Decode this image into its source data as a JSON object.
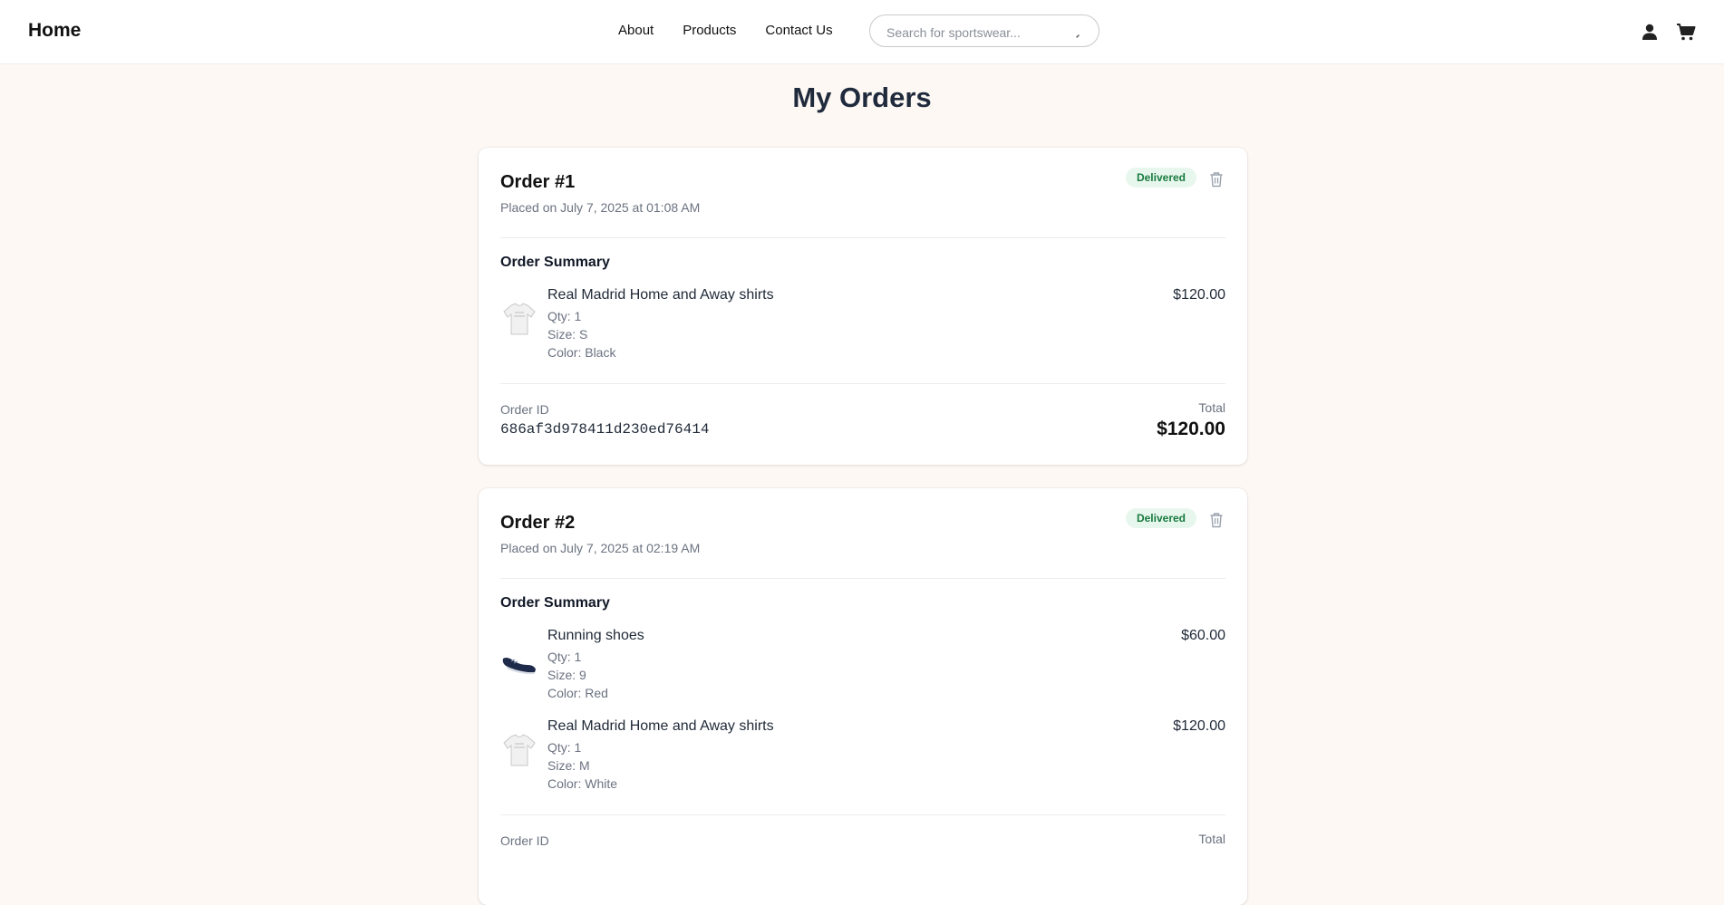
{
  "header": {
    "brand": "Home",
    "nav": [
      "About",
      "Products",
      "Contact Us"
    ],
    "search_placeholder": "Search for sportswear..."
  },
  "page": {
    "title": "My Orders"
  },
  "colors": {
    "accent": "#1f2a3c",
    "delivered_bg": "#e8f7ed",
    "delivered_text": "#177a3e",
    "page_bg": "#fdf8f4"
  },
  "orders": [
    {
      "title": "Order #1",
      "date": "Placed on July 7, 2025 at 01:08 AM",
      "status": "Delivered",
      "summary_title": "Order Summary",
      "items": [
        {
          "name": "Real Madrid Home and Away shirts",
          "qty": "Qty: 1",
          "size": "Size: S",
          "color": "Color: Black",
          "price": "$120.00",
          "icon": "shirt-icon"
        }
      ],
      "id_label": "Order ID",
      "id": "686af3d978411d230ed76414",
      "total_label": "Total",
      "total": "$120.00"
    },
    {
      "title": "Order #2",
      "date": "Placed on July 7, 2025 at 02:19 AM",
      "status": "Delivered",
      "summary_title": "Order Summary",
      "items": [
        {
          "name": "Running shoes",
          "qty": "Qty: 1",
          "size": "Size: 9",
          "color": "Color: Red",
          "price": "$60.00",
          "icon": "shoe-icon"
        },
        {
          "name": "Real Madrid Home and Away shirts",
          "qty": "Qty: 1",
          "size": "Size: M",
          "color": "Color: White",
          "price": "$120.00",
          "icon": "shirt-icon"
        }
      ],
      "id_label": "Order ID",
      "total_label": "Total"
    }
  ]
}
